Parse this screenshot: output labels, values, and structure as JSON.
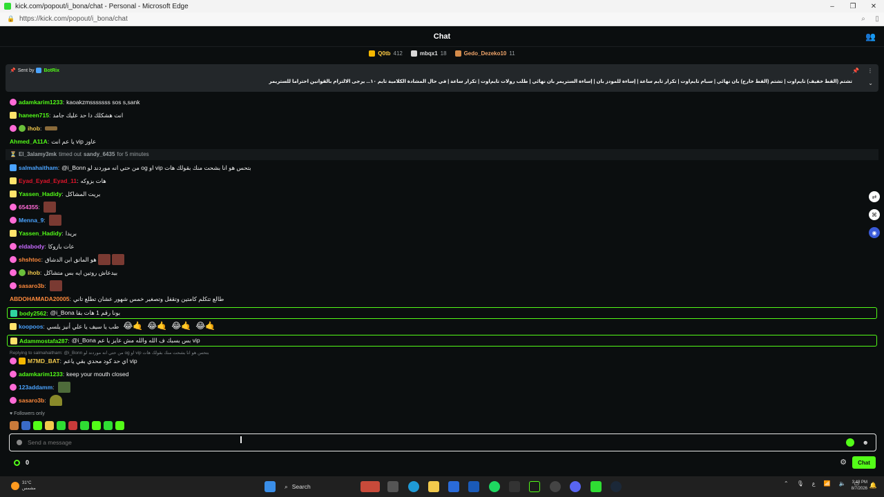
{
  "window": {
    "title": "kick.com/popout/i_bona/chat - Personal - Microsoft Edge",
    "url": "https://kick.com/popout/i_bona/chat"
  },
  "chat_header": {
    "title": "Chat"
  },
  "leaders": [
    {
      "name": "Q0tb",
      "count": "412",
      "color": "#f5b700"
    },
    {
      "name": "mbqx1",
      "count": "18",
      "color": "#d9d9d9"
    },
    {
      "name": "Gedo_Dezeko10",
      "count": "11",
      "color": "#d48b4a"
    }
  ],
  "pinned": {
    "sent_by_label": "Sent by",
    "bot_name": "BotRix",
    "text": "تشتم (القط خفيف) تايم‌اوت | تشتم (القط خارج) بان نهائي | سبام تايم‌اوت | تكرار تايم ساعة | إساءة للمودز بان | إساءة الستريمر بان نهائي | طلب رولات تايم‌اوت | تكرار ساعة | في حال المشادة الكلامية تايم ١٠... يرجى الالتزام بالقوانين احتراما للستريمر"
  },
  "messages": [
    {
      "user": "adamkarim1233",
      "color": "#53fc18",
      "badge": "#ff6bd6",
      "text": "kaoakzmsssssss sos s,sank"
    },
    {
      "user": "haneen715",
      "color": "#53fc18",
      "badge": "#ffe36b",
      "text": "انت هشكلك دا حد عليك جامد"
    },
    {
      "user": "ihob",
      "color": "#f2c94c",
      "badge": "#ff6bd6",
      "text": ""
    },
    {
      "user": "Ahmed_A11A",
      "color": "#53fc18",
      "badge": "",
      "text": "يا عم انت vip عاوز"
    },
    {
      "user": "salmahaitham",
      "color": "#4aa3ff",
      "badge": "#4aa3ff",
      "text": "@i_Bonn من حتي انه موردند لو og او vip بتحس هو انا بشحت منك بقولك هات"
    },
    {
      "user": "Eyad_Eyad_Eyad_11",
      "color": "#e0152b",
      "badge": "#ffe36b",
      "text": "هات بزوكه"
    },
    {
      "user": "Yassen_Hadidy",
      "color": "#53fc18",
      "badge": "#ffe36b",
      "text": "بريت المشاكل"
    },
    {
      "user": "654355",
      "color": "#ff6bd6",
      "badge": "#ff6bd6",
      "text": ""
    },
    {
      "user": "Menna_9",
      "color": "#4aa3ff",
      "badge": "#ff6bd6",
      "text": ""
    },
    {
      "user": "Yassen_Hadidy",
      "color": "#53fc18",
      "badge": "#ffe36b",
      "text": "بريدا"
    },
    {
      "user": "eldabody",
      "color": "#c86bff",
      "badge": "#ff6bd6",
      "text": "عات بازوكا"
    },
    {
      "user": "shshtoc",
      "color": "#ff8a3c",
      "badge": "#ff6bd6",
      "text": "هو الماتق ابن الدشاق"
    },
    {
      "user": "ihob",
      "color": "#f2c94c",
      "badge": "#ff6bd6",
      "text": "بيدعاش روتين ايه بس متشاكل"
    },
    {
      "user": "sasaro3b",
      "color": "#ff8a3c",
      "badge": "#ff6bd6",
      "text": ""
    },
    {
      "user": "ABDOHAMADA20005",
      "color": "#ff8a3c",
      "badge": "",
      "text": "طالع تتكلم كامتين وتقفل وتصغير خمس شهور عشان تطلع تاني"
    },
    {
      "user": "body2562",
      "color": "#53fc18",
      "badge": "#2fd5a0",
      "text": "@i_Bona بونا رقم 1 هات بقا"
    },
    {
      "user": "koopoos",
      "color": "#4aa3ff",
      "badge": "#ffe36b",
      "text": "طب يا سيف يا علي أنيز يلسي"
    },
    {
      "user": "Adammostafa287",
      "color": "#53fc18",
      "badge": "#ffe36b",
      "text": "@i_Bona بس بسبك ف الله والله مش عايز يا عم vip"
    },
    {
      "user": "M7MD_BAT",
      "color": "#f2c94c",
      "badge": "#ff6bd6",
      "text": "اي حد كود محدي بقي ياعم vip"
    },
    {
      "user": "adamkarim1233",
      "color": "#53fc18",
      "badge": "#ff6bd6",
      "text": "keep your mouth closed"
    },
    {
      "user": "123addamm",
      "color": "#4aa3ff",
      "badge": "#ff6bd6",
      "text": ""
    },
    {
      "user": "sasaro3b",
      "color": "#ff8a3c",
      "badge": "#ff6bd6",
      "text": ""
    }
  ],
  "system": {
    "moderator": "El_3alamy3mk",
    "action": "timed out",
    "target": "sandy_6435",
    "duration": "for 5 minutes"
  },
  "reply_hint": "Replying to salmahaitham: @i_Bonn من حتي انه موردند لو og او vip بتحس هو انا بشحت منك بقولك هات",
  "followers_only": "Followers only",
  "input": {
    "placeholder": "Send a message"
  },
  "footer": {
    "points": "0",
    "chat_button": "Chat"
  },
  "taskbar": {
    "temp": "31°C",
    "condition": "مشمس",
    "search": "Search",
    "time": "3:48 PM",
    "date": "8/7/2026"
  }
}
